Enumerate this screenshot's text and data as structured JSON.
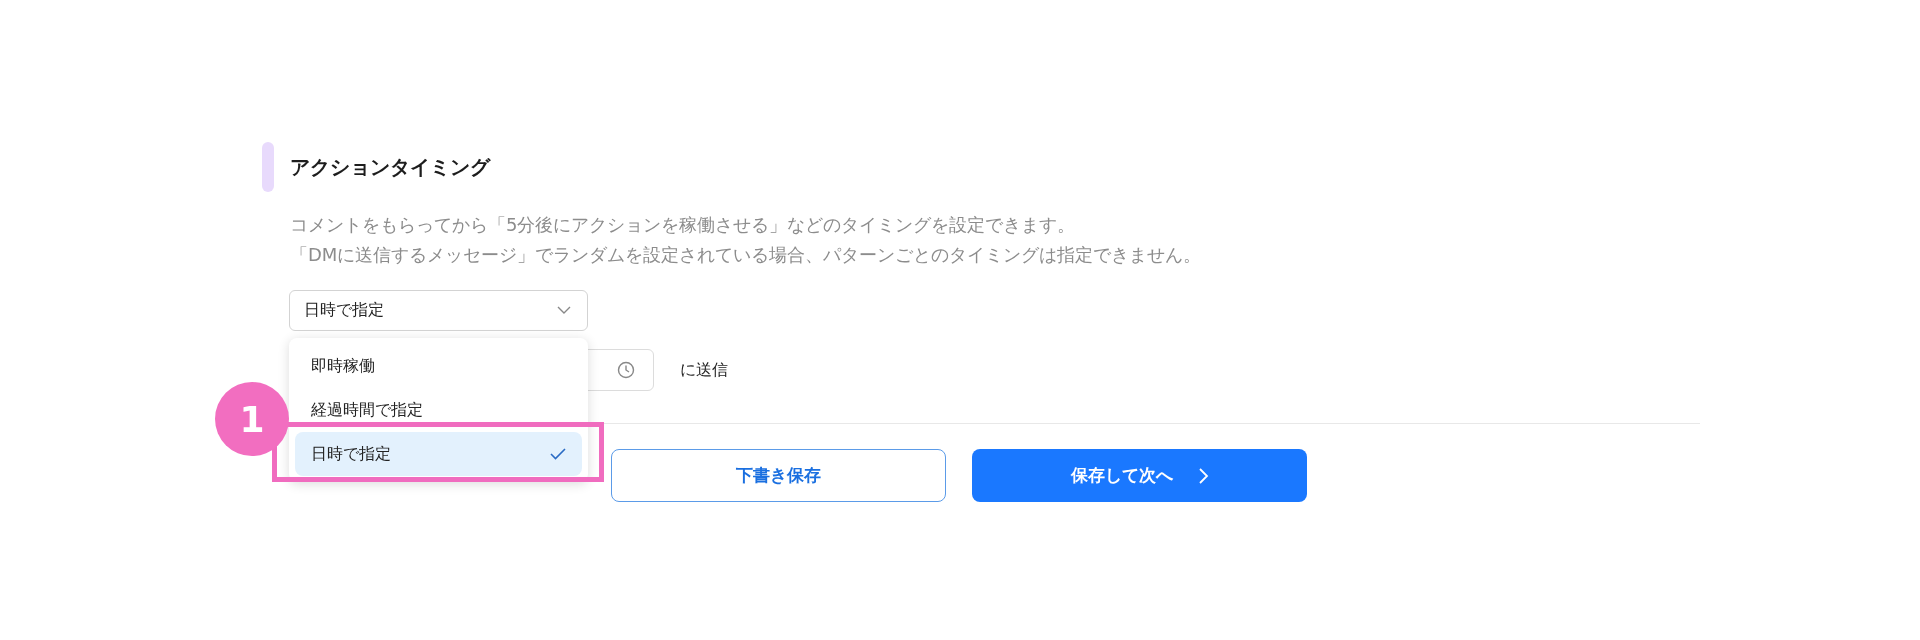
{
  "section": {
    "title": "アクションタイミング",
    "description": [
      "コメントをもらってから「5分後にアクションを稼働させる」などのタイミングを設定できます。",
      "「DMに送信するメッセージ」でランダムを設定されている場合、パターンごとのタイミングは指定できません。"
    ]
  },
  "timing_select": {
    "value": "日時で指定",
    "expanded": true
  },
  "options": [
    {
      "label": "即時稼働",
      "selected": false
    },
    {
      "label": "経過時間で指定",
      "selected": false
    },
    {
      "label": "日時で指定",
      "selected": true
    }
  ],
  "send_suffix": "に送信",
  "buttons": [
    {
      "label": "下書き保存",
      "kind": "secondary"
    },
    {
      "label": "保存して次へ",
      "kind": "primary"
    }
  ],
  "annotation": {
    "number": "1"
  }
}
